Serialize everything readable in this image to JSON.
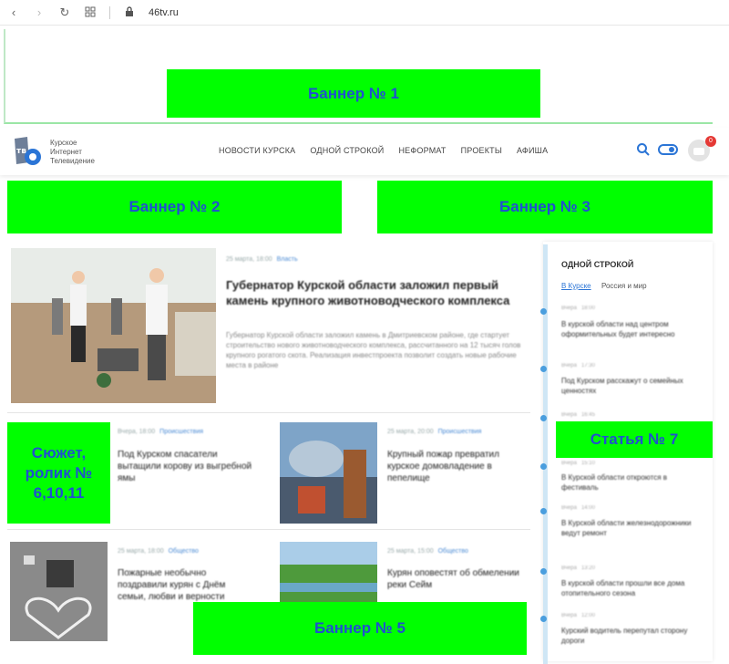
{
  "browser": {
    "url": "46tv.ru"
  },
  "banners": {
    "b1": "Баннер № 1",
    "b2": "Баннер № 2",
    "b3": "Баннер № 3",
    "b5": "Баннер № 5",
    "b7": "Статья № 7",
    "story": "Сюжет, ролик № 6,10,11"
  },
  "header": {
    "logo_lines": [
      "Курское",
      "Интернет",
      "Телевидение"
    ],
    "nav": [
      "НОВОСТИ КУРСКА",
      "ОДНОЙ СТРОКОЙ",
      "НЕФОРМАТ",
      "ПРОЕКТЫ",
      "АФИША"
    ],
    "cart_count": "0"
  },
  "feature": {
    "date": "25 марта, 18:00",
    "tag": "Власть",
    "title": "Губернатор Курской области заложил первый камень крупного животноводческого комплекса",
    "text": "Губернатор Курской области заложил камень в Дмитриевском районе, где стартует строительство нового животноводческого комплекса, рассчитанного на 12 тысяч голов крупного рогатого скота. Реализация инвестпроекта позволит создать новые рабочие места в районе"
  },
  "cards": [
    {
      "date": "Вчера, 18:00",
      "tag": "Происшествия",
      "title": "Под Курском спасатели вытащили корову из выгребной ямы"
    },
    {
      "date": "25 марта, 20:00",
      "tag": "Происшествия",
      "title": "Крупный пожар превратил курское домовладение в пепелище"
    },
    {
      "date": "25 марта, 18:00",
      "tag": "Общество",
      "title": "Пожарные необычно поздравили курян с Днём семьи, любви и верности"
    },
    {
      "date": "25 марта, 15:00",
      "tag": "Общество",
      "title": "Курян оповестят об обмелении реки Сейм"
    }
  ],
  "sidebar": {
    "title": "ОДНОЙ СТРОКОЙ",
    "tabs": [
      "В Курске",
      "Россия и мир"
    ],
    "items": [
      {
        "date": "Вчера",
        "time": "18:00",
        "title": "В курской области над центром оформительных будет интересно"
      },
      {
        "date": "Вчера",
        "time": "17:30",
        "title": "Под Курском расскажут о семейных ценностях"
      },
      {
        "date": "Вчера",
        "time": "16:45",
        "title": ""
      },
      {
        "date": "Вчера",
        "time": "15:10",
        "title": "В Курской области откроются в фестиваль"
      },
      {
        "date": "Вчера",
        "time": "14:00",
        "title": "В Курской области железнодорожники ведут ремонт"
      },
      {
        "date": "Вчера",
        "time": "13:20",
        "title": "В курской области прошли все дома отопительного сезона"
      },
      {
        "date": "Вчера",
        "time": "12:00",
        "title": "Курский водитель перепутал сторону дороги"
      }
    ]
  },
  "colors": {
    "banner": "#00ff00",
    "banner_text": "#2050d0",
    "accent": "#2b75d6"
  }
}
